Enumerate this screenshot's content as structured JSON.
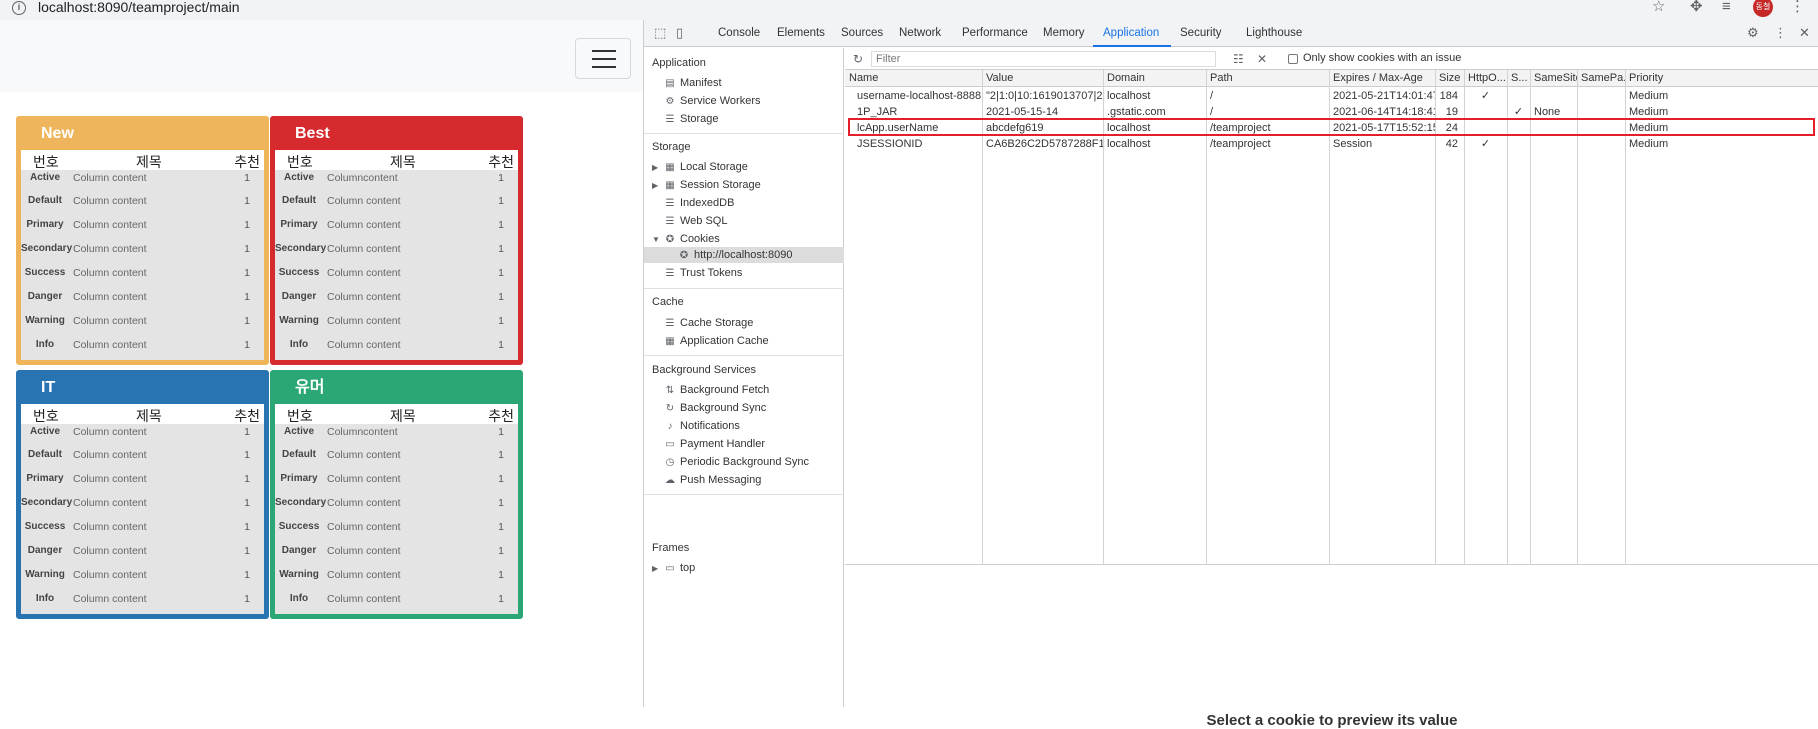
{
  "browser": {
    "url_host": "localhost",
    "url_rest": ":8090/teamproject/main",
    "avatar_text": "동철"
  },
  "boards": [
    {
      "title": "New",
      "color": "#f0b55a",
      "head_color": "#eeb55c",
      "headers": [
        "번호",
        "제목",
        "추천"
      ],
      "rows": [
        {
          "c1": "Active",
          "c2": "Column content",
          "c3": "1"
        },
        {
          "c1": "Default",
          "c2": "Column content",
          "c3": "1"
        },
        {
          "c1": "Primary",
          "c2": "Column content",
          "c3": "1"
        },
        {
          "c1": "Secondary",
          "c2": "Column content",
          "c3": "1"
        },
        {
          "c1": "Success",
          "c2": "Column content",
          "c3": "1"
        },
        {
          "c1": "Danger",
          "c2": "Column content",
          "c3": "1"
        },
        {
          "c1": "Warning",
          "c2": "Column content",
          "c3": "1"
        },
        {
          "c1": "Info",
          "c2": "Column content",
          "c3": "1"
        }
      ]
    },
    {
      "title": "Best",
      "color": "#d62a2f",
      "head_color": "#d62a2f",
      "headers": [
        "번호",
        "제목",
        "추천"
      ],
      "rows": [
        {
          "c1": "Active",
          "c2": "Columncontent",
          "c3": "1"
        },
        {
          "c1": "Default",
          "c2": "Column content",
          "c3": "1"
        },
        {
          "c1": "Primary",
          "c2": "Column content",
          "c3": "1"
        },
        {
          "c1": "Secondary",
          "c2": "Column content",
          "c3": "1"
        },
        {
          "c1": "Success",
          "c2": "Column content",
          "c3": "1"
        },
        {
          "c1": "Danger",
          "c2": "Column content",
          "c3": "1"
        },
        {
          "c1": "Warning",
          "c2": "Column content",
          "c3": "1"
        },
        {
          "c1": "Info",
          "c2": "Column content",
          "c3": "1"
        }
      ]
    },
    {
      "title": "IT",
      "color": "#2874b3",
      "head_color": "#2874b3",
      "headers": [
        "번호",
        "제목",
        "추천"
      ],
      "rows": [
        {
          "c1": "Active",
          "c2": "Column content",
          "c3": "1"
        },
        {
          "c1": "Default",
          "c2": "Column content",
          "c3": "1"
        },
        {
          "c1": "Primary",
          "c2": "Column content",
          "c3": "1"
        },
        {
          "c1": "Secondary",
          "c2": "Column content",
          "c3": "1"
        },
        {
          "c1": "Success",
          "c2": "Column content",
          "c3": "1"
        },
        {
          "c1": "Danger",
          "c2": "Column content",
          "c3": "1"
        },
        {
          "c1": "Warning",
          "c2": "Column content",
          "c3": "1"
        },
        {
          "c1": "Info",
          "c2": "Column content",
          "c3": "1"
        }
      ]
    },
    {
      "title": "유머",
      "color": "#2aa774",
      "head_color": "#2aa774",
      "headers": [
        "번호",
        "제목",
        "추천"
      ],
      "rows": [
        {
          "c1": "Active",
          "c2": "Columncontent",
          "c3": "1"
        },
        {
          "c1": "Default",
          "c2": "Column content",
          "c3": "1"
        },
        {
          "c1": "Primary",
          "c2": "Column content",
          "c3": "1"
        },
        {
          "c1": "Secondary",
          "c2": "Column content",
          "c3": "1"
        },
        {
          "c1": "Success",
          "c2": "Column content",
          "c3": "1"
        },
        {
          "c1": "Danger",
          "c2": "Column content",
          "c3": "1"
        },
        {
          "c1": "Warning",
          "c2": "Column content",
          "c3": "1"
        },
        {
          "c1": "Info",
          "c2": "Column content",
          "c3": "1"
        }
      ]
    }
  ],
  "devtools": {
    "tabs": [
      "Console",
      "Elements",
      "Sources",
      "Network",
      "Performance",
      "Memory",
      "Application",
      "Security",
      "Lighthouse"
    ],
    "active_tab": "Application",
    "sidebar": {
      "application_title": "Application",
      "application_items": [
        "Manifest",
        "Service Workers",
        "Storage"
      ],
      "storage_title": "Storage",
      "storage_items": [
        "Local Storage",
        "Session Storage",
        "IndexedDB",
        "Web SQL",
        "Cookies"
      ],
      "cookie_origin": "http://localhost:8090",
      "trust_tokens": "Trust Tokens",
      "cache_title": "Cache",
      "cache_items": [
        "Cache Storage",
        "Application Cache"
      ],
      "bg_title": "Background Services",
      "bg_items": [
        "Background Fetch",
        "Background Sync",
        "Notifications",
        "Payment Handler",
        "Periodic Background Sync",
        "Push Messaging"
      ],
      "frames_title": "Frames",
      "frames_item": "top"
    },
    "filter_placeholder": "Filter",
    "only_issue_label": "Only show cookies with an issue",
    "columns": [
      "Name",
      "Value",
      "Domain",
      "Path",
      "Expires / Max-Age",
      "Size",
      "HttpO...",
      "S...",
      "SameSite",
      "SamePa...",
      "Priority"
    ],
    "cookies": [
      {
        "name": "username-localhost-8888",
        "value": "\"2|1:0|10:1619013707|23:...",
        "domain": "localhost",
        "path": "/",
        "expires": "2021-05-21T14:01:47....",
        "size": "184",
        "httponly": "✓",
        "secure": "",
        "samesite": "",
        "sameparty": "",
        "priority": "Medium"
      },
      {
        "name": "1P_JAR",
        "value": "2021-05-15-14",
        "domain": ".gstatic.com",
        "path": "/",
        "expires": "2021-06-14T14:18:41....",
        "size": "19",
        "httponly": "",
        "secure": "✓",
        "samesite": "None",
        "sameparty": "",
        "priority": "Medium"
      },
      {
        "name": "lcApp.userName",
        "value": "abcdefg619",
        "domain": "localhost",
        "path": "/teamproject",
        "expires": "2021-05-17T15:52:15....",
        "size": "24",
        "httponly": "",
        "secure": "",
        "samesite": "",
        "sameparty": "",
        "priority": "Medium"
      },
      {
        "name": "JSESSIONID",
        "value": "CA6B26C2D5787288F11D...",
        "domain": "localhost",
        "path": "/teamproject",
        "expires": "Session",
        "size": "42",
        "httponly": "✓",
        "secure": "",
        "samesite": "",
        "sameparty": "",
        "priority": "Medium"
      }
    ],
    "preview_text": "Select a cookie to preview its value"
  }
}
